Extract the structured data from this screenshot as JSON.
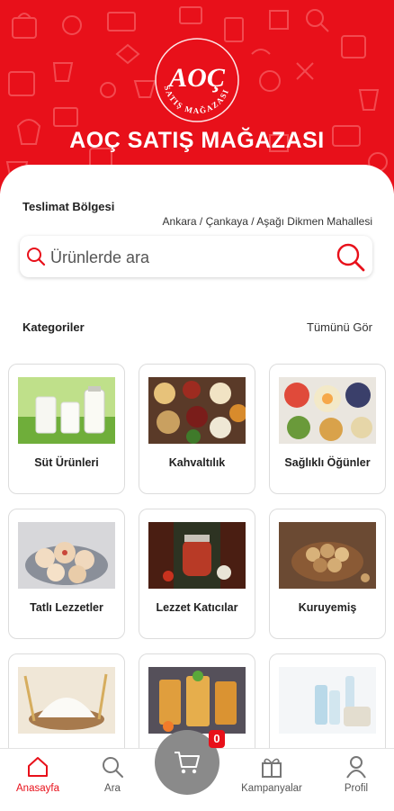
{
  "header": {
    "brand_title": "AOÇ SATIŞ MAĞAZASI",
    "logo_monogram": "AOÇ",
    "logo_ring_text": "SATIŞ MAĞAZASI"
  },
  "delivery": {
    "title": "Teslimat Bölgesi",
    "path": "Ankara  / Çankaya / Aşağı Dikmen Mahallesi"
  },
  "search": {
    "placeholder": "Ürünlerde ara",
    "left_icon": "search-icon",
    "right_icon": "search-icon"
  },
  "categories": {
    "title": "Kategoriler",
    "see_all": "Tümünü Gör",
    "items": [
      {
        "label": "Süt Ürünleri",
        "icon": "milk-photo"
      },
      {
        "label": "Kahvaltılık",
        "icon": "breakfast-photo"
      },
      {
        "label": "Sağlıklı Öğünler",
        "icon": "healthy-photo"
      },
      {
        "label": "Tatlı Lezzetler",
        "icon": "cookies-photo"
      },
      {
        "label": "Lezzet Katıcılar",
        "icon": "sauce-photo"
      },
      {
        "label": "Kuruyemiş",
        "icon": "nuts-photo"
      },
      {
        "label": "",
        "icon": "flour-photo"
      },
      {
        "label": "",
        "icon": "drinks-photo"
      },
      {
        "label": "",
        "icon": "cleaning-photo"
      }
    ]
  },
  "bottom_nav": {
    "home": "Anasayfa",
    "search": "Ara",
    "campaigns": "Kampanyalar",
    "profile": "Profil",
    "cart_count": "0"
  },
  "colors": {
    "brand_red": "#e8101a",
    "cart_gray": "#8a8a8a"
  }
}
